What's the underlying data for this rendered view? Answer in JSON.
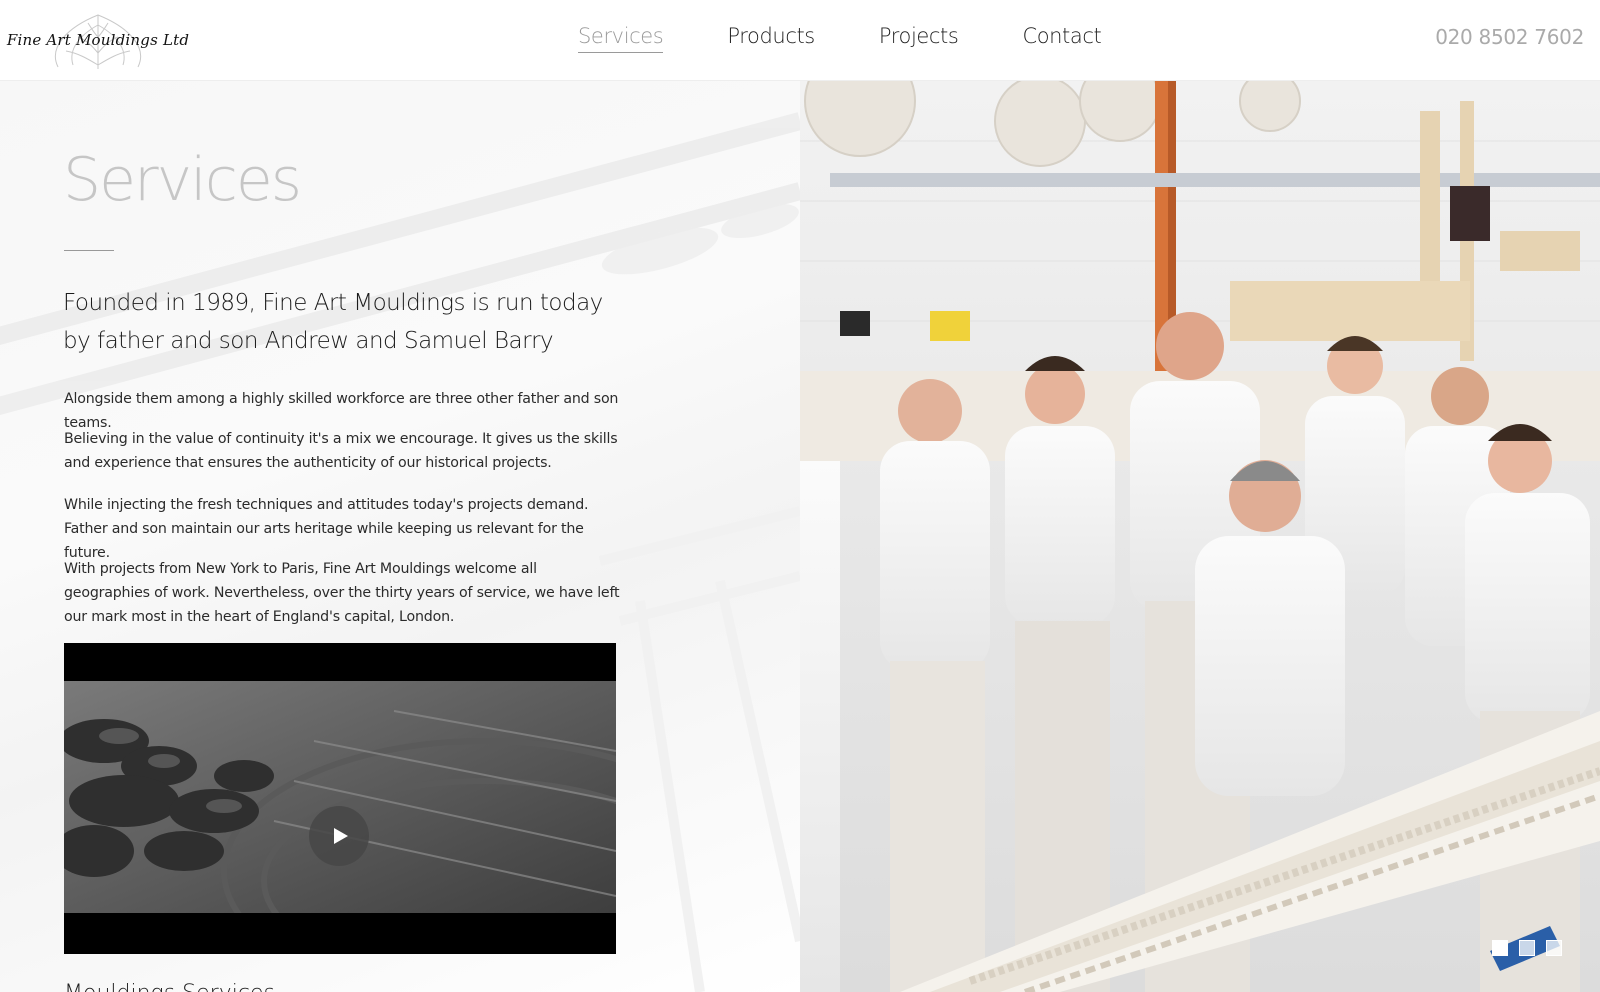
{
  "brand": {
    "logo_text": "Fine Art Mouldings Ltd",
    "logo_icon": "acanthus-leaf-icon"
  },
  "nav": {
    "items": [
      {
        "label": "Services",
        "active": true
      },
      {
        "label": "Products",
        "active": false
      },
      {
        "label": "Projects",
        "active": false
      },
      {
        "label": "Contact",
        "active": false
      }
    ],
    "phone": "020 8502 7602"
  },
  "content": {
    "title": "Services",
    "lead": "Founded in 1989, Fine Art Mouldings is run today by father and son Andrew and Samuel Barry",
    "paragraphs": [
      "Alongside them among a highly skilled workforce are three other father and son teams.",
      "Believing in the value of continuity it's a mix we encourage. It gives us the skills and experience that ensures the authenticity of our historical projects.",
      "While injecting the fresh techniques and attitudes today's projects demand. Father and son maintain our arts heritage while keeping us relevant for the future.",
      "With projects from New York to Paris, Fine Art Mouldings welcome all geographies of work. Nevertheless, over the thirty years of service, we have left our mark most in the heart of England's capital, London."
    ],
    "next_heading": "Mouldings Services"
  },
  "video": {
    "play_icon": "play-icon"
  },
  "slider": {
    "dots": 3,
    "active_index": 0
  },
  "colors": {
    "accent_inactive": "#9a9a9a",
    "title_grey": "#c6c6c6",
    "phone_grey": "#aaaaaa"
  }
}
